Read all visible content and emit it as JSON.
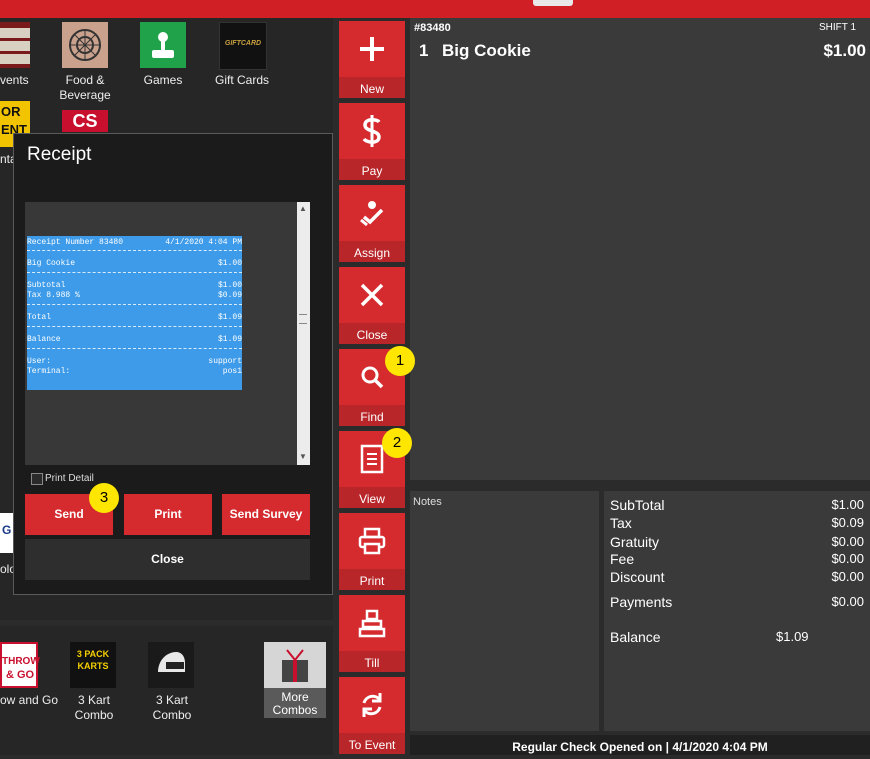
{
  "products": {
    "tiles": [
      {
        "label": "vents",
        "icon": "celebrate-icon"
      },
      {
        "label": "Food & Beverage",
        "icon": "food-icon"
      },
      {
        "label": "Games",
        "icon": "games-icon"
      },
      {
        "label": "Gift Cards",
        "icon": "gift-card-icon"
      },
      {
        "label": "nta",
        "icon": "tor-event-icon"
      }
    ],
    "gift_card_text": "GIFTCARD",
    "tor_text": [
      "OR",
      "ENT"
    ],
    "cs_text": "CS",
    "bottom_tiles": [
      {
        "label": "ow and Go",
        "line1": "THROW",
        "line2": "& GO"
      },
      {
        "label": "3 Kart Combo",
        "text": "3 PACK KARTS"
      },
      {
        "label": "3 Kart Combo",
        "icon": "helmet-icon"
      },
      {
        "label": "More Combos"
      }
    ],
    "partial_left": [
      "G",
      "olo"
    ]
  },
  "commands": [
    {
      "label": "New",
      "icon": "plus-icon"
    },
    {
      "label": "Pay",
      "icon": "dollar-icon"
    },
    {
      "label": "Assign",
      "icon": "assign-icon"
    },
    {
      "label": "Close",
      "icon": "x-icon"
    },
    {
      "label": "Find",
      "icon": "search-icon"
    },
    {
      "label": "View",
      "icon": "document-icon"
    },
    {
      "label": "Print",
      "icon": "printer-icon"
    },
    {
      "label": "Till",
      "icon": "till-icon"
    },
    {
      "label": "To Event",
      "icon": "refresh-icon"
    }
  ],
  "check": {
    "number": "#83480",
    "shift": "SHIFT 1",
    "line_qty": "1",
    "line_item": "Big Cookie",
    "line_price": "$1.00"
  },
  "notes_label": "Notes",
  "totals": {
    "subtotal_label": "SubTotal",
    "subtotal": "$1.00",
    "tax_label": "Tax",
    "tax": "$0.09",
    "gratuity_label": "Gratuity",
    "gratuity": "$0.00",
    "fee_label": "Fee",
    "fee": "$0.00",
    "discount_label": "Discount",
    "discount": "$0.00",
    "payments_label": "Payments",
    "payments": "$0.00",
    "balance_label": "Balance",
    "balance": "$1.09"
  },
  "status_bar": "Regular Check Opened on  |  4/1/2020 4:04 PM",
  "dialog": {
    "title": "Receipt",
    "receipt": {
      "header_left": "Receipt Number 83480",
      "header_right": "4/1/2020 4:04 PM",
      "item": "Big Cookie",
      "item_price": "$1.00",
      "subtotal_label": "Subtotal",
      "subtotal": "$1.00",
      "tax_label": "Tax 8.988 %",
      "tax": "$0.09",
      "total_label": "Total",
      "total": "$1.09",
      "balance_label": "Balance",
      "balance": "$1.09",
      "user_label": "User:",
      "user": "support",
      "terminal_label": "Terminal:",
      "terminal": "pos1"
    },
    "print_detail_label": "Print Detail",
    "send_label": "Send",
    "print_label": "Print",
    "survey_label": "Send Survey",
    "close_label": "Close"
  },
  "markers": [
    "1",
    "2",
    "3"
  ],
  "colors": {
    "accent": "#d52b2f",
    "receipt_bg": "#3d9be9",
    "marker": "#ffe600"
  }
}
